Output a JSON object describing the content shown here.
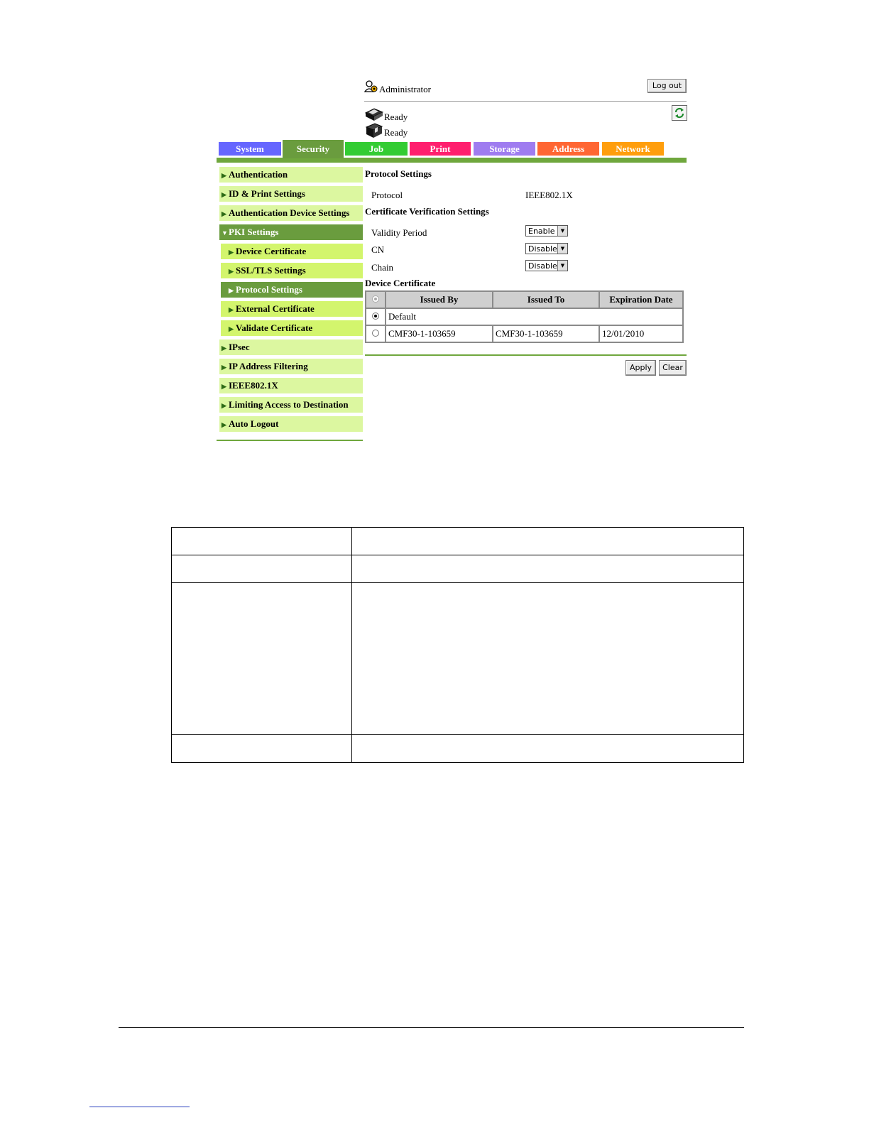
{
  "header": {
    "user_label": "Administrator",
    "logout_label": "Log out",
    "status": [
      {
        "label": "Ready"
      },
      {
        "label": "Ready"
      }
    ]
  },
  "tabs": [
    {
      "label": "System",
      "color": "#6666ff"
    },
    {
      "label": "Security",
      "color": "#6a9c3e",
      "active": true
    },
    {
      "label": "Job",
      "color": "#33cc33"
    },
    {
      "label": "Print",
      "color": "#ff1f6e"
    },
    {
      "label": "Storage",
      "color": "#9f7cf0"
    },
    {
      "label": "Address",
      "color": "#ff6633"
    },
    {
      "label": "Network",
      "color": "#ff9e0d"
    }
  ],
  "sidebar": {
    "items": [
      {
        "label": "Authentication",
        "arrow": "▶"
      },
      {
        "label": "ID & Print Settings",
        "arrow": "▶"
      },
      {
        "label": "Authentication Device Settings",
        "arrow": "▶"
      },
      {
        "label": "PKI Settings",
        "arrow": "▼",
        "active": true
      },
      {
        "label": "Device Certificate",
        "arrow": "▶",
        "sub": true
      },
      {
        "label": "SSL/TLS Settings",
        "arrow": "▶",
        "sub": true
      },
      {
        "label": "Protocol Settings",
        "arrow": "▶",
        "sub": true,
        "active": true
      },
      {
        "label": "External Certificate",
        "arrow": "▶",
        "sub": true
      },
      {
        "label": "Validate Certificate",
        "arrow": "▶",
        "sub": true
      },
      {
        "label": "IPsec",
        "arrow": "▶"
      },
      {
        "label": "IP Address Filtering",
        "arrow": "▶"
      },
      {
        "label": "IEEE802.1X",
        "arrow": "▶"
      },
      {
        "label": "Limiting Access to Destination",
        "arrow": "▶"
      },
      {
        "label": "Auto Logout",
        "arrow": "▶"
      }
    ]
  },
  "main": {
    "protocol_settings_title": "Protocol Settings",
    "protocol_label": "Protocol",
    "protocol_value": "IEEE802.1X",
    "cert_verification_title": "Certificate Verification Settings",
    "validity_period_label": "Validity Period",
    "validity_period_value": "Enable",
    "cn_label": "CN",
    "cn_value": "Disable",
    "chain_label": "Chain",
    "chain_value": "Disable",
    "device_certificate_title": "Device Certificate",
    "table": {
      "headers": [
        "Issued By",
        "Issued To",
        "Expiration Date"
      ],
      "default_label": "Default",
      "row": {
        "issued_by": "CMF30-1-103659",
        "issued_to": "CMF30-1-103659",
        "expiration": "12/01/2010"
      }
    },
    "apply_label": "Apply",
    "clear_label": "Clear"
  }
}
